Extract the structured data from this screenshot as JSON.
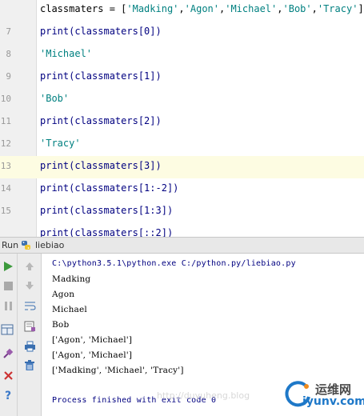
{
  "editor": {
    "lines": [
      {
        "num": "",
        "text": "classmaters = ['Madking','Agon','Michael','Bob','Tracy']",
        "kind": "assign"
      },
      {
        "num": "7",
        "text": "print(classmaters[0])",
        "kind": "code"
      },
      {
        "num": "8",
        "text": "'Michael'",
        "kind": "str"
      },
      {
        "num": "9",
        "text": "print(classmaters[1])",
        "kind": "code"
      },
      {
        "num": "10",
        "text": "'Bob'",
        "kind": "str"
      },
      {
        "num": "11",
        "text": "print(classmaters[2])",
        "kind": "code"
      },
      {
        "num": "12",
        "text": "'Tracy'",
        "kind": "str"
      },
      {
        "num": "13",
        "text": "print(classmaters[3])",
        "kind": "code"
      },
      {
        "num": "14",
        "text": "print(classmaters[1:-2])",
        "kind": "code"
      },
      {
        "num": "15",
        "text": "print(classmaters[1:3])",
        "kind": "code"
      },
      {
        "num": "",
        "text": "print(classmaters[::2])",
        "kind": "code"
      }
    ],
    "current_line": "13"
  },
  "run": {
    "label": "Run",
    "config_name": "liebiao"
  },
  "console": {
    "command": "C:\\python3.5.1\\python.exe C:/python.py/liebiao.py",
    "output": [
      "Madking",
      "Agon",
      "Michael",
      "Bob",
      "['Agon', 'Michael']",
      "['Agon', 'Michael']",
      "['Madking', 'Michael', 'Tracy']"
    ],
    "exit": "Process finished with exit code 0"
  },
  "watermark": {
    "text": "http://duyuheng.blog",
    "logo_cn": "运维网",
    "logo_en": "iyunv.com"
  },
  "colors": {
    "code": "#000080",
    "string": "#008080",
    "current_line_bg": "#fdfce2",
    "run_green": "#3c9a3c",
    "stop_red": "#cc3333"
  }
}
